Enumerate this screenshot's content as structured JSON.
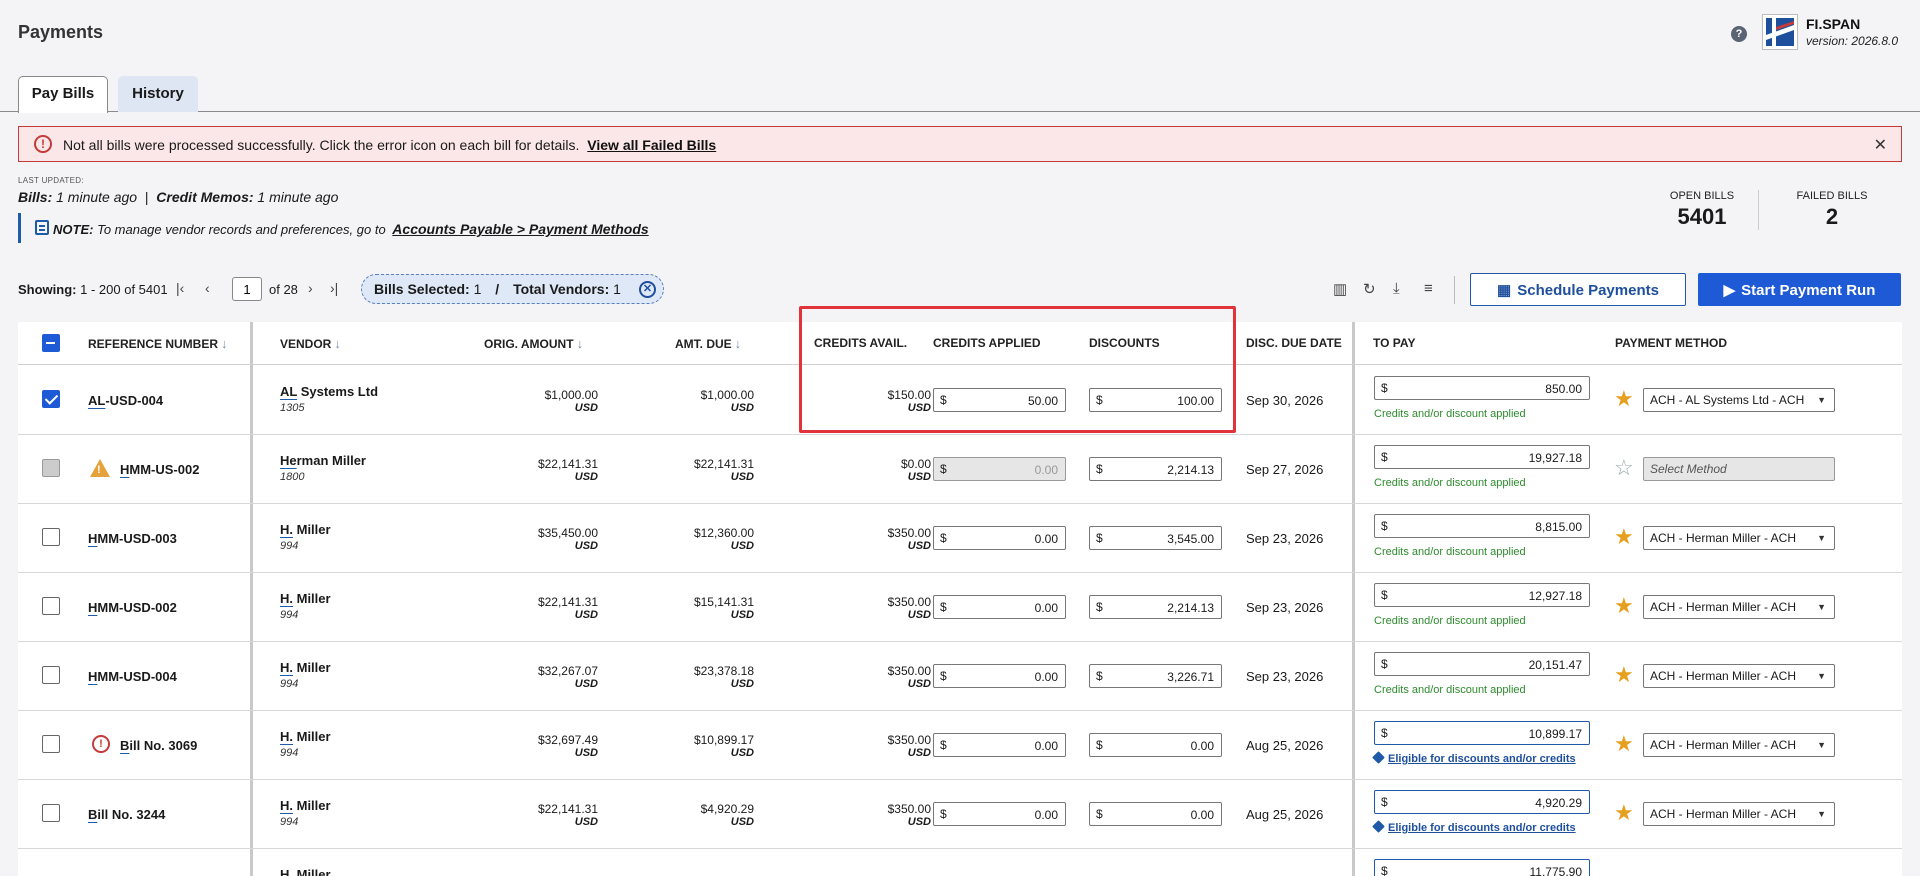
{
  "page": {
    "title": "Payments",
    "help": "?",
    "brand": "FI.SPAN",
    "version": "version: 2026.8.0"
  },
  "tabs": [
    {
      "label": "Pay Bills"
    },
    {
      "label": "History"
    }
  ],
  "alert": {
    "icon": "!",
    "message": "Not all bills were processed successfully. Click the error icon on each bill for details.",
    "link": "View all Failed Bills",
    "close": "✕"
  },
  "last_updated": {
    "label": "LAST UPDATED:",
    "bills_label": "Bills:",
    "bills_value": "1 minute ago",
    "separator": "|",
    "memos_label": "Credit Memos:",
    "memos_value": "1 minute ago"
  },
  "note": {
    "label": "NOTE:",
    "text": "To manage vendor records and preferences, go to",
    "link": "Accounts Payable > Payment Methods"
  },
  "stats": {
    "open_label": "OPEN BILLS",
    "open_value": "5401",
    "failed_label": "FAILED BILLS",
    "failed_value": "2"
  },
  "pagination": {
    "showing_label": "Showing:",
    "showing_value": "1 - 200 of 5401",
    "first": "|‹",
    "prev": "‹",
    "page": "1",
    "of": "of 28",
    "next": "›",
    "last": "›|"
  },
  "selection": {
    "bills_label": "Bills Selected:",
    "bills_value": "1",
    "sep": "/",
    "vendors_label": "Total Vendors:",
    "vendors_value": "1",
    "clear": "✕"
  },
  "toolbar": {
    "columns": "▥",
    "refresh": "↻",
    "download": "⤓",
    "filter": "≡",
    "schedule": "Schedule Payments",
    "start": "Start Payment Run",
    "schedule_icon": "▦",
    "start_icon": "▶"
  },
  "columns": {
    "ref": "REFERENCE NUMBER",
    "vendor": "VENDOR",
    "orig": "ORIG. AMOUNT",
    "due": "AMT. DUE",
    "credits_avail": "CREDITS AVAIL.",
    "credits_applied": "CREDITS APPLIED",
    "discounts": "DISCOUNTS",
    "disc_due": "DISC. DUE DATE",
    "to_pay": "TO PAY",
    "method": "PAYMENT METHOD",
    "sort": "↓"
  },
  "rows": [
    {
      "ref_u": "AL",
      "ref_r": "-USD-004",
      "vendor_u": "AL",
      "vendor_r": " Systems Ltd",
      "vendor_id": "1305",
      "orig": "$1,000.00",
      "due": "$1,000.00",
      "credits": "$150.00",
      "cur": "USD",
      "applied": "50.00",
      "discount": "100.00",
      "date": "Sep 30, 2026",
      "topay": "850.00",
      "note": "Credits and/or discount applied",
      "method": "ACH - AL Systems Ltd - ACH",
      "dollar": "$"
    },
    {
      "ref_u": "H",
      "ref_r": "MM-US-002",
      "vendor_u": "He",
      "vendor_r": "rman Miller",
      "vendor_id": "1800",
      "orig": "$22,141.31",
      "due": "$22,141.31",
      "credits": "$0.00",
      "cur": "USD",
      "applied": "0.00",
      "discount": "2,214.13",
      "date": "Sep 27, 2026",
      "topay": "19,927.18",
      "note": "Credits and/or discount applied",
      "method": "Select Method",
      "dollar": "$"
    },
    {
      "ref_u": "H",
      "ref_r": "MM-USD-003",
      "vendor_u": "H.",
      "vendor_r": " Miller",
      "vendor_id": "994",
      "orig": "$35,450.00",
      "due": "$12,360.00",
      "credits": "$350.00",
      "cur": "USD",
      "applied": "0.00",
      "discount": "3,545.00",
      "date": "Sep 23, 2026",
      "topay": "8,815.00",
      "note": "Credits and/or discount applied",
      "method": "ACH - Herman Miller - ACH",
      "dollar": "$"
    },
    {
      "ref_u": "H",
      "ref_r": "MM-USD-002",
      "vendor_u": "H.",
      "vendor_r": " Miller",
      "vendor_id": "994",
      "orig": "$22,141.31",
      "due": "$15,141.31",
      "credits": "$350.00",
      "cur": "USD",
      "applied": "0.00",
      "discount": "2,214.13",
      "date": "Sep 23, 2026",
      "topay": "12,927.18",
      "note": "Credits and/or discount applied",
      "method": "ACH - Herman Miller - ACH",
      "dollar": "$"
    },
    {
      "ref_u": "H",
      "ref_r": "MM-USD-004",
      "vendor_u": "H.",
      "vendor_r": " Miller",
      "vendor_id": "994",
      "orig": "$32,267.07",
      "due": "$23,378.18",
      "credits": "$350.00",
      "cur": "USD",
      "applied": "0.00",
      "discount": "3,226.71",
      "date": "Sep 23, 2026",
      "topay": "20,151.47",
      "note": "Credits and/or discount applied",
      "method": "ACH - Herman Miller - ACH",
      "dollar": "$"
    },
    {
      "ref_u": "B",
      "ref_r": "ill No. 3069",
      "vendor_u": "H.",
      "vendor_r": " Miller",
      "vendor_id": "994",
      "orig": "$32,697.49",
      "due": "$10,899.17",
      "credits": "$350.00",
      "cur": "USD",
      "applied": "0.00",
      "discount": "0.00",
      "date": "Aug 25, 2026",
      "topay": "10,899.17",
      "note": "Eligible for discounts and/or credits",
      "method": "ACH - Herman Miller - ACH",
      "dollar": "$"
    },
    {
      "ref_u": "B",
      "ref_r": "ill No. 3244",
      "vendor_u": "H.",
      "vendor_r": " Miller",
      "vendor_id": "994",
      "orig": "$22,141.31",
      "due": "$4,920.29",
      "credits": "$350.00",
      "cur": "USD",
      "applied": "0.00",
      "discount": "0.00",
      "date": "Aug 25, 2026",
      "topay": "4,920.29",
      "note": "Eligible for discounts and/or credits",
      "method": "ACH - Herman Miller - ACH",
      "dollar": "$"
    },
    {
      "ref_u": "",
      "ref_r": "",
      "vendor_u": "H.",
      "vendor_r": " Miller",
      "vendor_id": "",
      "orig": "",
      "due": "",
      "credits": "",
      "cur": "",
      "applied": "",
      "discount": "",
      "date": "",
      "topay": "11,775.90",
      "note": "",
      "method": "",
      "dollar": "$"
    }
  ]
}
